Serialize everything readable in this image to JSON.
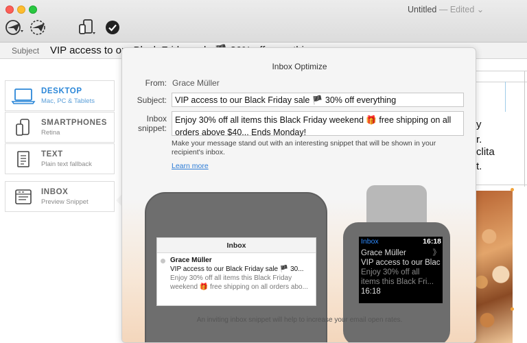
{
  "window": {
    "title": "Untitled",
    "status": "— Edited ⌄"
  },
  "subject_bar": {
    "label": "Subject",
    "value": "VIP access to our Black Friday sale 🏴 30% off everything"
  },
  "sidebar": {
    "items": [
      {
        "title": "DESKTOP",
        "subtitle": "Mac, PC & Tablets",
        "icon": "laptop-icon",
        "active": true
      },
      {
        "title": "SMARTPHONES",
        "subtitle": "Retina",
        "icon": "phones-icon",
        "active": false
      },
      {
        "title": "TEXT",
        "subtitle": "Plain text fallback",
        "icon": "document-icon",
        "active": false
      },
      {
        "title": "INBOX",
        "subtitle": "Preview Snippet",
        "icon": "inbox-icon",
        "active": false
      }
    ]
  },
  "background_text": {
    "line1": "y",
    "line2": "r.",
    "line3": "clita",
    "line4": "t."
  },
  "popover": {
    "title": "Inbox Optimize",
    "from_label": "From:",
    "from_value": "Grace Müller",
    "subject_label": "Subject:",
    "subject_value": "VIP access to our Black Friday sale 🏴 30% off everything",
    "snippet_label_1": "Inbox",
    "snippet_label_2": "snippet:",
    "snippet_value": "Enjoy 30% off all items this Black Friday weekend 🎁 free shipping on all orders above $40... Ends Monday!",
    "hint": "Make your message stand out with an interesting snippet that will be shown in your recipient's inbox.",
    "learn_more": "Learn more",
    "footer": "An inviting inbox snippet will help to increase your email open rates."
  },
  "phone_preview": {
    "header": "Inbox",
    "from": "Grace Müller",
    "subject": "VIP access to our Black Friday sale 🏴 30...",
    "snippet": "Enjoy 30% off all items this Black Friday weekend 🎁 free shipping on all orders abo..."
  },
  "watch_preview": {
    "app": "Inbox",
    "time": "16:18",
    "from": "Grace Müller",
    "chevron": "》",
    "subject": "VIP access to our Blac",
    "snippet": "Enjoy 30% off all items this Black Fri...",
    "footer_time": "16:18"
  },
  "colors": {
    "accent": "#2b87d8",
    "link": "#2b7bd6"
  }
}
